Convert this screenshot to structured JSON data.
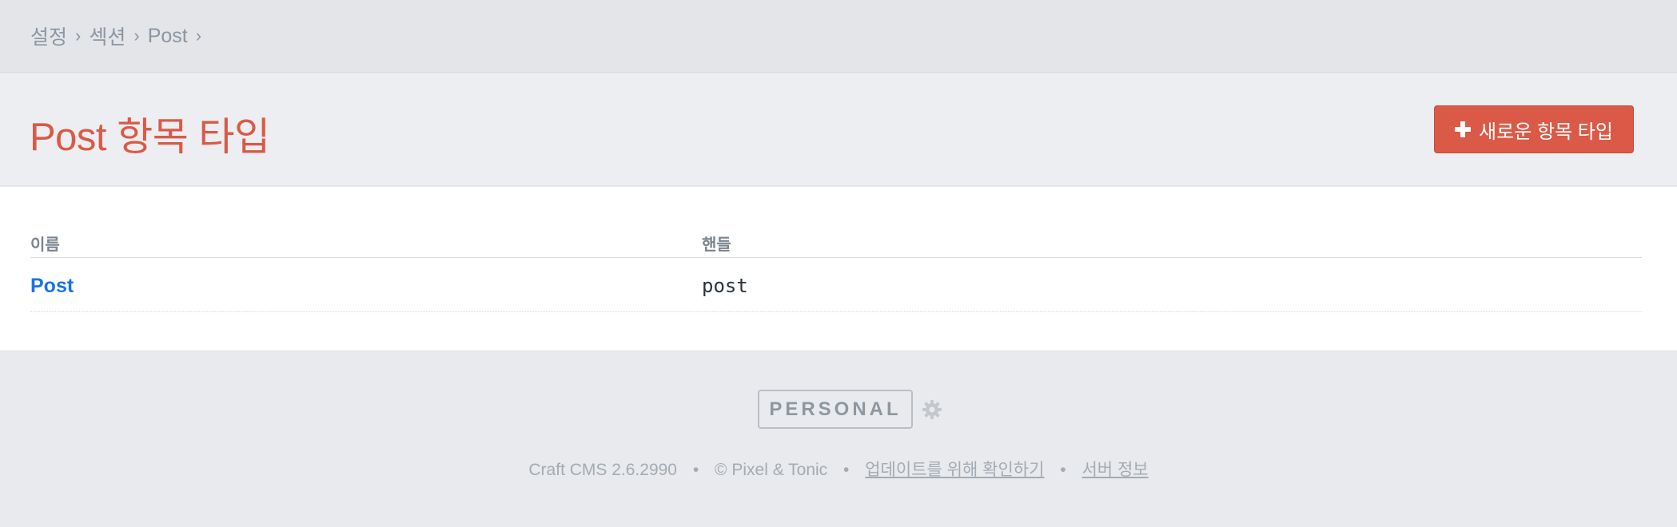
{
  "breadcrumb": {
    "items": [
      {
        "label": "설정"
      },
      {
        "label": "섹션"
      },
      {
        "label": "Post"
      }
    ],
    "separator": "›"
  },
  "header": {
    "title": "Post 항목 타입",
    "new_button_label": "새로운 항목 타입",
    "new_button_icon": "plus-icon"
  },
  "table": {
    "columns": [
      "이름",
      "핸들"
    ],
    "rows": [
      {
        "name": "Post",
        "handle": "post"
      }
    ]
  },
  "footer": {
    "edition": "PERSONAL",
    "settings_icon": "gear-icon",
    "version": "Craft CMS 2.6.2990",
    "copyright": "© Pixel & Tonic",
    "update_link": "업데이트를 위해 확인하기",
    "server_info_link": "서버 정보",
    "separator": "•"
  },
  "colors": {
    "accent": "#da5a47",
    "link": "#1a73e8",
    "muted": "#8b96a2"
  }
}
